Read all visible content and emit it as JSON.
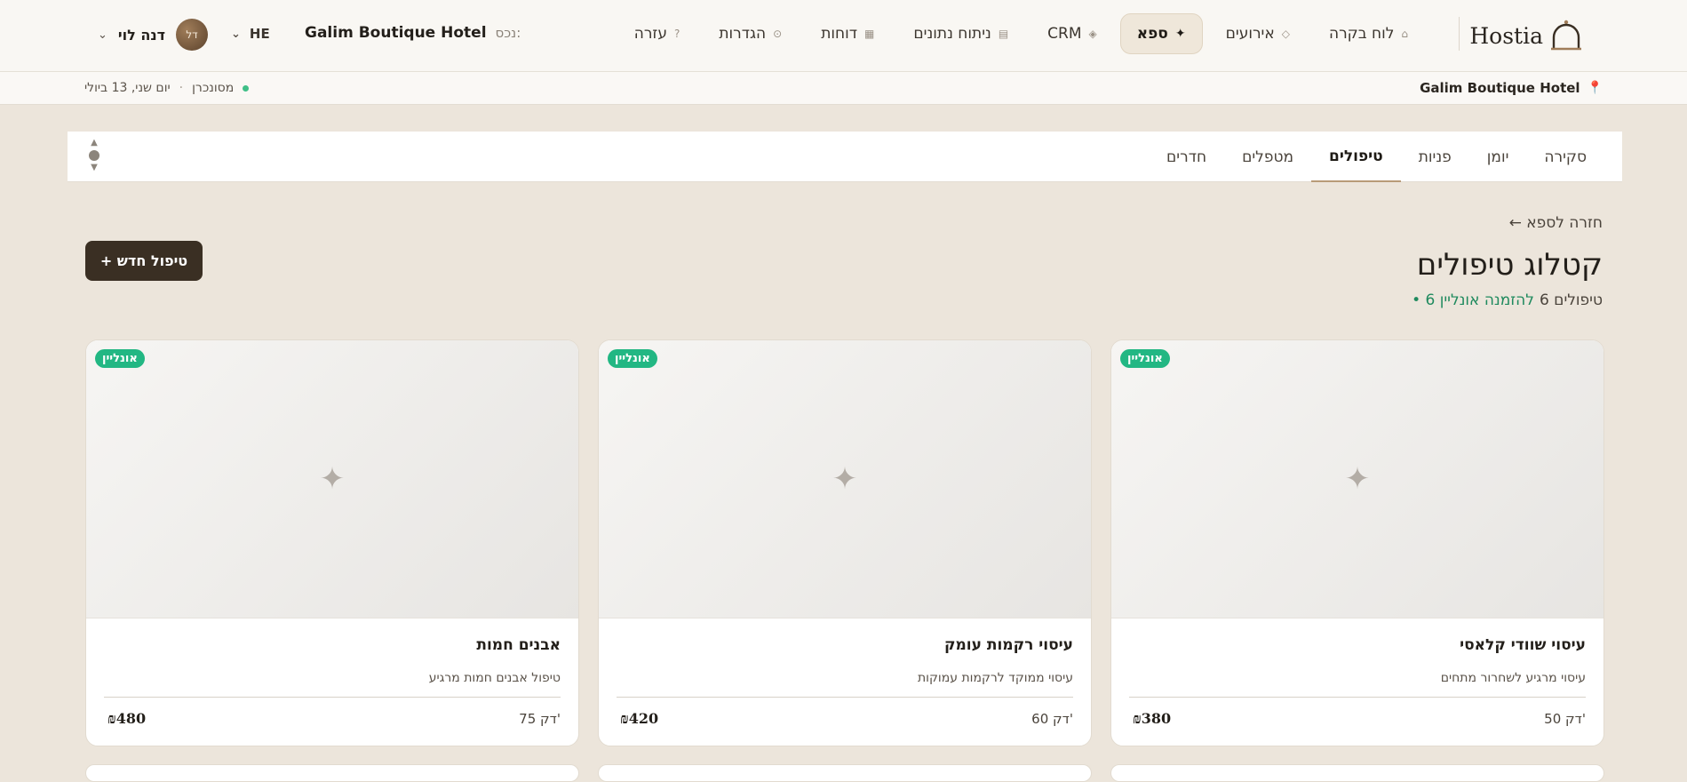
{
  "app": {
    "name": "Hostia"
  },
  "nav": [
    {
      "label": "לוח בקרה",
      "icon": "home-icon",
      "glyph": "⌂"
    },
    {
      "label": "אירועים",
      "icon": "diamond-icon",
      "glyph": "◇"
    },
    {
      "label": "ספא",
      "icon": "sparkle-icon",
      "glyph": "✦",
      "active": true
    },
    {
      "label": "CRM",
      "icon": "crm-icon",
      "glyph": "◈"
    },
    {
      "label": "ניתוח נתונים",
      "icon": "analytics-icon",
      "glyph": "▤"
    },
    {
      "label": "דוחות",
      "icon": "reports-icon",
      "glyph": "▦"
    },
    {
      "label": "הגדרות",
      "icon": "settings-icon",
      "glyph": "⊙"
    },
    {
      "label": "עזרה",
      "icon": "help-icon",
      "glyph": "?"
    }
  ],
  "property": {
    "label": "נכס:",
    "value": "Galim Boutique Hotel"
  },
  "language": {
    "value": "HE"
  },
  "user": {
    "name": "דנה לוי",
    "initials": "דל"
  },
  "status": {
    "hotel": "Galim Boutique Hotel",
    "sync": "מסונכרן",
    "date": "יום שני, 13 ביולי"
  },
  "tabs": [
    {
      "label": "סקירה"
    },
    {
      "label": "יומן"
    },
    {
      "label": "פניות"
    },
    {
      "label": "טיפולים",
      "active": true
    },
    {
      "label": "מטפלים"
    },
    {
      "label": "חדרים"
    }
  ],
  "page": {
    "back": "← חזרה לספא",
    "title": "קטלוג טיפולים",
    "count": "6 טיפולים",
    "online": "• 6 להזמנה אונליין",
    "new_button": "+ טיפול חדש"
  },
  "treatments": [
    {
      "name": "עיסוי שוודי קלאסי",
      "description": "עיסוי מרגיע לשחרור מתחים",
      "duration": "50 דק'",
      "price": "₪380",
      "badge": "אונליין"
    },
    {
      "name": "עיסוי רקמות עומק",
      "description": "עיסוי ממוקד לרקמות עמוקות",
      "duration": "60 דק'",
      "price": "₪420",
      "badge": "אונליין"
    },
    {
      "name": "אבנים חמות",
      "description": "טיפול אבנים חמות מרגיע",
      "duration": "75 דק'",
      "price": "₪480",
      "badge": "אונליין"
    }
  ],
  "colors": {
    "accent": "#3a2f23",
    "online_badge": "#22b783",
    "background": "#ece5db"
  }
}
